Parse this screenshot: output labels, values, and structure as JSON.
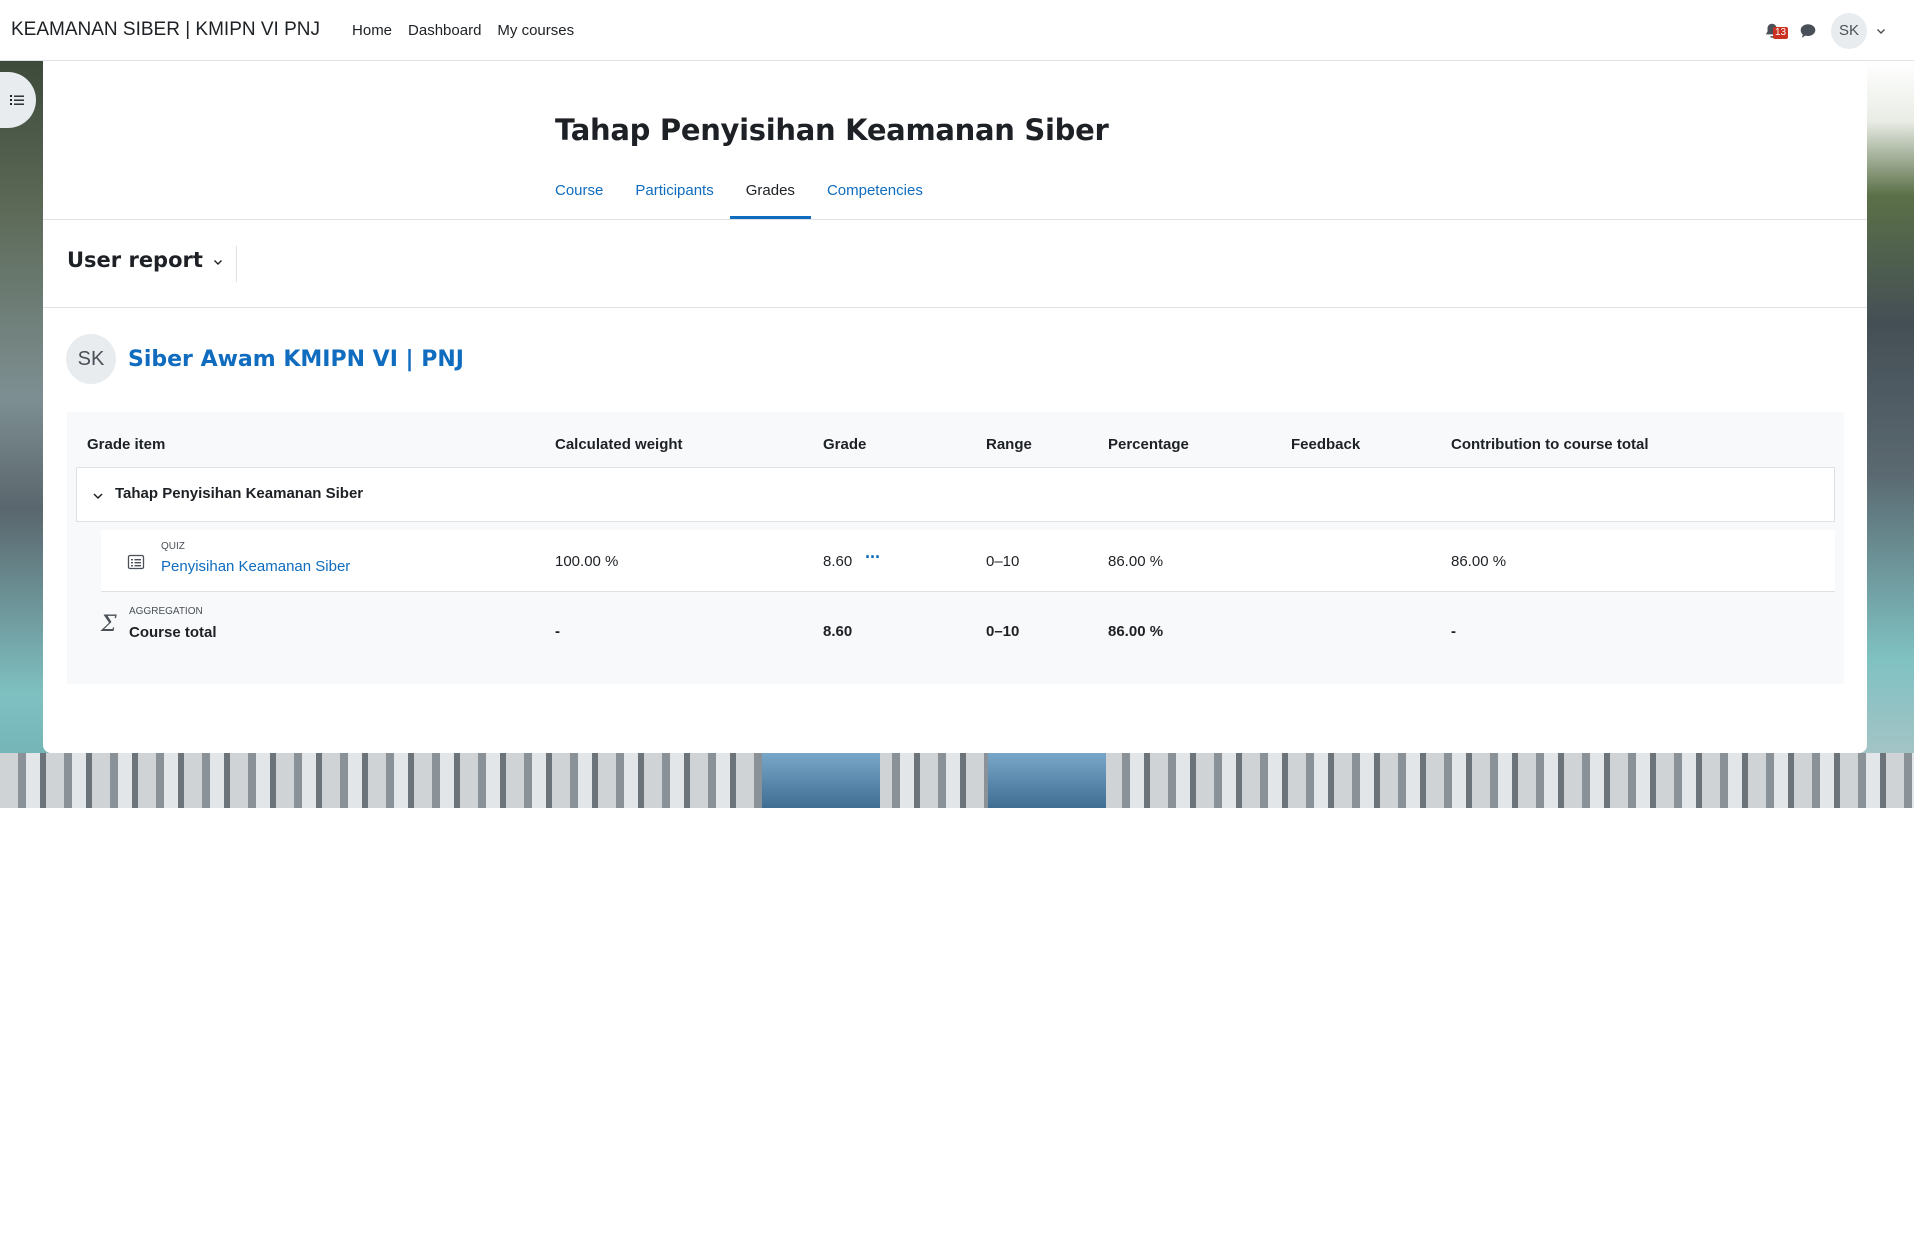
{
  "navbar": {
    "site_name": "KEAMANAN SIBER | KMIPN VI PNJ",
    "links": [
      "Home",
      "Dashboard",
      "My courses"
    ],
    "notification_count": "13",
    "user_initials": "SK"
  },
  "course": {
    "title": "Tahap Penyisihan Keamanan Siber",
    "tabs": [
      {
        "label": "Course",
        "active": false
      },
      {
        "label": "Participants",
        "active": false
      },
      {
        "label": "Grades",
        "active": true
      },
      {
        "label": "Competencies",
        "active": false
      }
    ]
  },
  "report": {
    "selector_label": "User report",
    "user_initials": "SK",
    "user_name": "Siber Awam KMIPN VI | PNJ"
  },
  "table": {
    "headers": [
      "Grade item",
      "Calculated weight",
      "Grade",
      "Range",
      "Percentage",
      "Feedback",
      "Contribution to course total"
    ],
    "category": "Tahap Penyisihan Keamanan Siber",
    "item": {
      "type": "QUIZ",
      "name": "Penyisihan Keamanan Siber",
      "weight": "100.00 %",
      "grade": "8.60",
      "range": "0–10",
      "percentage": "86.00 %",
      "feedback": "",
      "contribution": "86.00 %"
    },
    "total": {
      "type": "AGGREGATION",
      "name": "Course total",
      "weight": "-",
      "grade": "8.60",
      "range": "0–10",
      "percentage": "86.00 %",
      "feedback": "",
      "contribution": "-"
    }
  },
  "colors": {
    "link": "#0f6cbf",
    "text": "#1d2125",
    "badge": "#ca3120"
  }
}
